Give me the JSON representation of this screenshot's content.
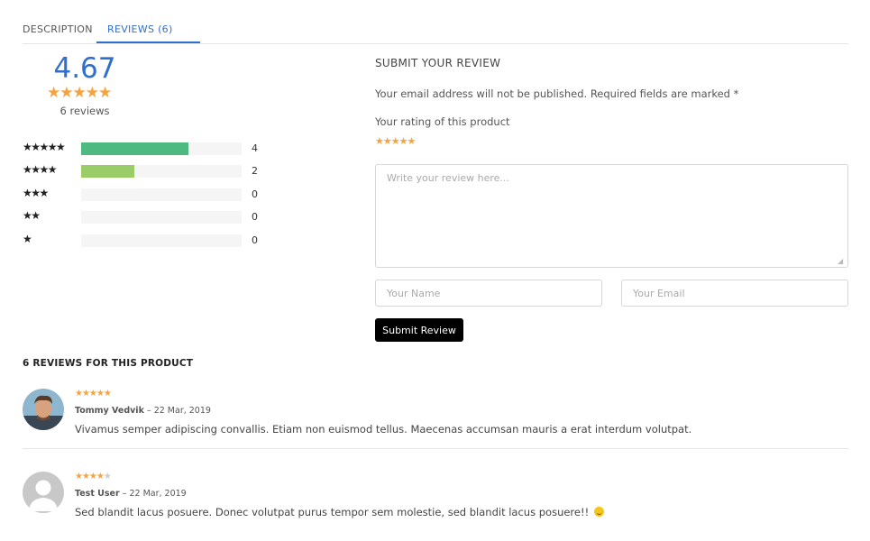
{
  "tabs": {
    "description": "DESCRIPTION",
    "reviews": "REVIEWS (6)"
  },
  "summary": {
    "average": "4.67",
    "average_stars": "★★★★★",
    "count_text": "6 reviews",
    "rows": [
      {
        "stars": "★★★★★",
        "count": "4",
        "fraction": 0.667,
        "color": "#4fb982"
      },
      {
        "stars": "★★★★",
        "count": "2",
        "fraction": 0.333,
        "color": "#9acd67"
      },
      {
        "stars": "★★★",
        "count": "0",
        "fraction": 0,
        "color": "#4fb982"
      },
      {
        "stars": "★★",
        "count": "0",
        "fraction": 0,
        "color": "#4fb982"
      },
      {
        "stars": "★",
        "count": "0",
        "fraction": 0,
        "color": "#4fb982"
      }
    ]
  },
  "submit": {
    "title": "SUBMIT YOUR REVIEW",
    "notice": "Your email address will not be published. Required fields are marked *",
    "rating_label": "Your rating of this product",
    "rating_stars": "★★★★★",
    "review_placeholder": "Write your review here...",
    "name_placeholder": "Your Name",
    "email_placeholder": "Your Email",
    "button": "Submit Review"
  },
  "reviews": {
    "heading": "6 REVIEWS FOR THIS PRODUCT",
    "items": [
      {
        "stars_filled": "★★★★★",
        "stars_empty": "",
        "author": "Tommy Vedvik",
        "date": "– 22 Mar, 2019",
        "body": "Vivamus semper adipiscing convallis. Etiam non euismod tellus. Maecenas accumsan mauris a erat interdum volutpat.",
        "avatar": "user-photo"
      },
      {
        "stars_filled": "★★★★",
        "stars_empty": "★",
        "author": "Test User",
        "date": "– 22 Mar, 2019",
        "body": "Sed blandit lacus posuere. Donec volutpat purus tempor sem molestie, sed blandit lacus posuere!!",
        "avatar": "default-avatar"
      }
    ]
  },
  "colors": {
    "accent": "#2f6fce",
    "star": "#f5a340",
    "bar_five": "#4fb982",
    "bar_four": "#9acd67"
  }
}
